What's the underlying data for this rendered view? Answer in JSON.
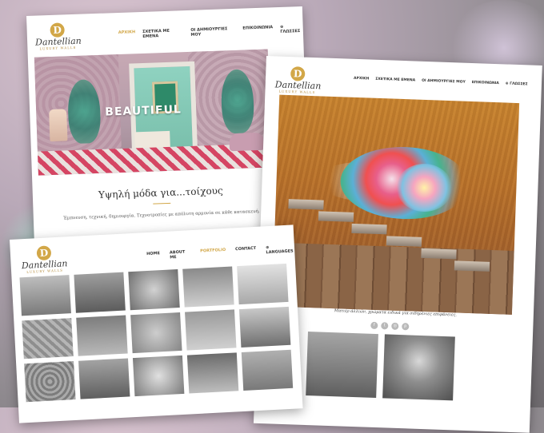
{
  "brand": {
    "name": "Dantellian",
    "subtitle": "LUXURY WALLS",
    "initial": "D",
    "accent": "#d2a748"
  },
  "page_greek": {
    "nav": [
      "ΑΡΧΙΚΗ",
      "ΣΧΕΤΙΚΑ ΜΕ ΕΜΕΝΑ",
      "ΟΙ ΔΗΜΙΟΥΡΓΙΕΣ ΜΟΥ",
      "ΕΠΙΚΟΙΝΩΝΙΑ",
      "⊕ ΓΛΩΣΣΕΣ"
    ],
    "active_nav": "ΑΡΧΙΚΗ",
    "hero_overlay": "BEAUTIFUL",
    "heading": "Υψηλή μόδα για...τοίχους",
    "tagline": "Έμπνευση, τεχνική, δημιουργία. Τεχνοτροπίες με απόλυτη αρμονία σε κάθε κατασκευή."
  },
  "page_art": {
    "nav": [
      "ΑΡΧΙΚΗ",
      "ΣΧΕΤΙΚΑ ΜΕ ΕΜΕΝΑ",
      "ΟΙ ΔΗΜΙΟΥΡΓΙΕΣ ΜΟΥ",
      "ΕΠΙΚΟΙΝΩΝΙΑ",
      "⊕ ΓΛΩΣΣΕΣ"
    ],
    "caption": "Ματιέρ άλλιών, χρώματα ειδικά για σιδηρένιες επιφάνειες.",
    "social_icons": [
      "facebook-icon",
      "twitter-icon",
      "instagram-icon",
      "pinterest-icon"
    ],
    "social_glyphs": [
      "f",
      "t",
      "◎",
      "p"
    ]
  },
  "page_portfolio": {
    "nav": [
      "HOME",
      "ABOUT ME",
      "PORTFOLIO",
      "CONTACT",
      "⊕ LANGUAGES"
    ],
    "active_nav": "PORTFOLIO",
    "thumbnails": 15
  }
}
